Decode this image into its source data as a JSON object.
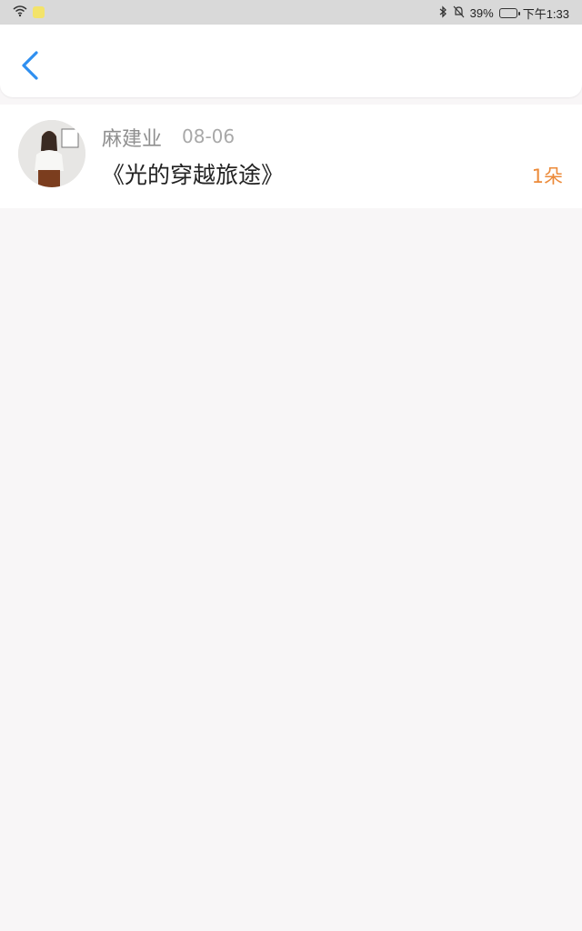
{
  "status_bar": {
    "battery": "39%",
    "time": "下午1:33"
  },
  "header": {
    "back_icon": "chevron-left-icon",
    "accent_color": "#2f8ff0"
  },
  "items": [
    {
      "author": "麻建业",
      "date": "08-06",
      "title": "《光的穿越旅途》",
      "count": "1朵",
      "avatar_icon": "user-avatar"
    }
  ],
  "colors": {
    "background": "#f8f6f7",
    "count": "#ec8a39"
  }
}
